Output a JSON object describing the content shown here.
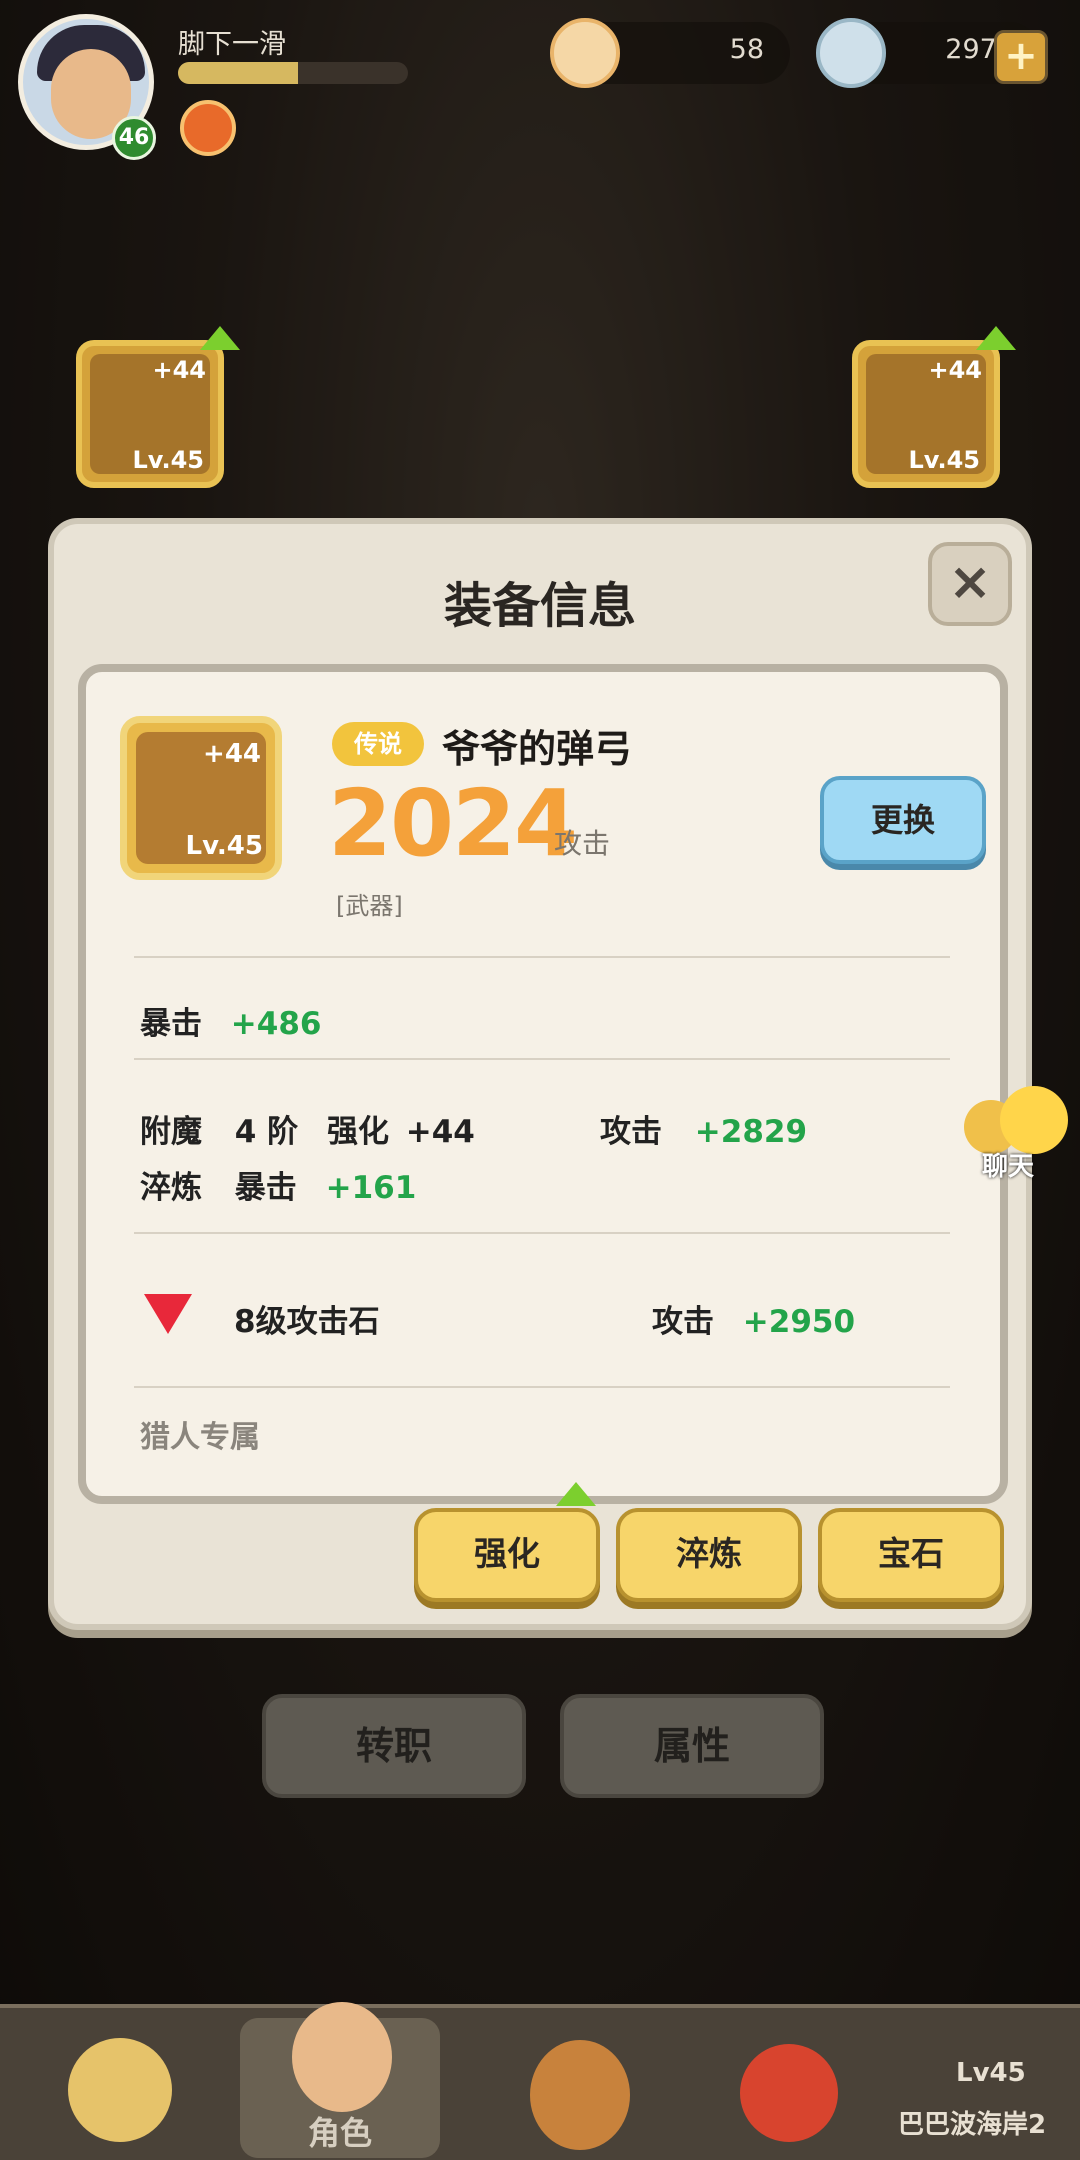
{
  "player": {
    "name": "脚下一滑",
    "level": "46",
    "xp_fraction": 0.52
  },
  "currencies": [
    {
      "name": "pearls",
      "value": "58"
    },
    {
      "name": "shells",
      "value": "2971"
    }
  ],
  "slots": [
    {
      "plus": "+44",
      "level": "Lv.45"
    },
    {
      "plus": "+44",
      "level": "Lv.45"
    }
  ],
  "panel": {
    "title": "装备信息",
    "close_label": "×",
    "item": {
      "rarity": "传说",
      "name": "爷爷的弹弓",
      "power": "2024",
      "power_label": "攻击",
      "slot_type": "[武器]",
      "plus": "+44",
      "level": "Lv.45",
      "swap_label": "更换"
    },
    "crit": {
      "label": "暴击",
      "value": "+486"
    },
    "enchant": {
      "label": "附魔",
      "tier": "4 阶",
      "enhance_label": "强化",
      "enhance_value": "+44",
      "atk_label": "攻击",
      "atk_value": "+2829"
    },
    "refine": {
      "label": "淬炼",
      "crit_label": "暴击",
      "crit_value": "+161"
    },
    "gem": {
      "name": "8级攻击石",
      "atk_label": "攻击",
      "atk_value": "+2950"
    },
    "exclusive": "猎人专属",
    "buttons": {
      "enhance": "强化",
      "refine": "淬炼",
      "gem": "宝石"
    }
  },
  "actions": {
    "job_change": "转职",
    "attributes": "属性"
  },
  "chat": {
    "label": "聊天"
  },
  "nav": {
    "role": "角色",
    "stage": "Lv45",
    "stage_name": "巴巴波海岸2"
  },
  "colors": {
    "accent_orange": "#f4a13a",
    "stat_green": "#23a44a",
    "legend_yellow": "#f2c43d",
    "swap_blue": "#9fd9f4"
  }
}
